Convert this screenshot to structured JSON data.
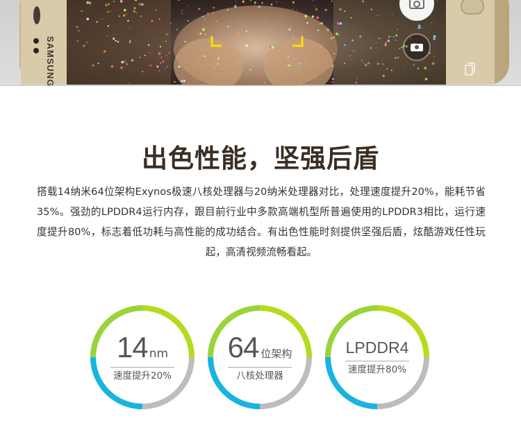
{
  "hero": {
    "brand_text": "SAMSUNG",
    "camera_icon": "camera-icon",
    "switch_icon": "camera-switch-icon",
    "gallery_icon": "gallery-icon"
  },
  "headline": "出色性能，坚强后盾",
  "intro": "搭载14纳米64位架构Exynos极速八核处理器与20纳米处理器对比，处理速度提升20%，能耗节省35%。强劲的LPDDR4运行内存，跟目前行业中多款高端机型所普遍使用的LPDDR3相比，运行速度提升80%，标志着低功耗与高性能的成功结合。有出色性能时刻提供坚强后盾，炫酷游戏任性玩起，高清视频流畅看起。",
  "stats": [
    {
      "big": "14",
      "unit": "nm",
      "caption": "速度提升20%"
    },
    {
      "big": "64",
      "unit": "位架构",
      "caption": "八核处理器"
    },
    {
      "big": "LPDDR4",
      "unit": "",
      "caption": "速度提升80%"
    }
  ],
  "colors": {
    "heading": "#3a2e23",
    "body": "#333333",
    "ring_green": "#b4dc1c",
    "ring_cyan": "#18b4e0",
    "ring_grey": "#bdbdbd",
    "frame_yellow": "#f7e300"
  }
}
